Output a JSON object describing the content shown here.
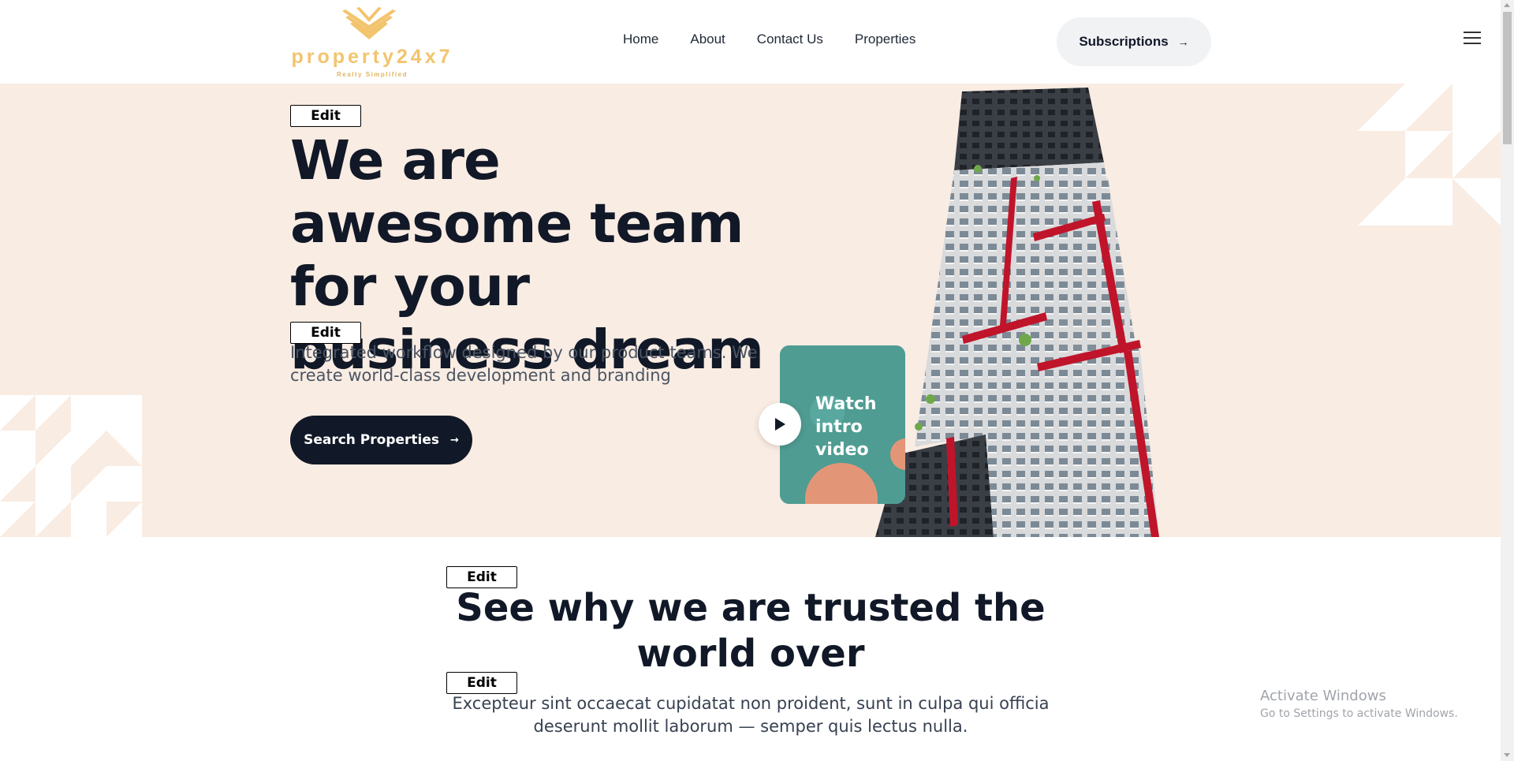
{
  "header": {
    "logo_text": "property24x7",
    "logo_tagline": "Realty Simplified",
    "nav": [
      "Home",
      "About",
      "Contact Us",
      "Properties"
    ],
    "subscriptions_label": "Subscriptions",
    "arrow": "→"
  },
  "hero": {
    "edit_label": "Edit",
    "title": "We are awesome team for your business dream",
    "subtitle": "Integrated workflow designed by our product teams. We create world-class development and branding",
    "search_label": "Search Properties",
    "video_label": "Watch intro video"
  },
  "trusted": {
    "edit_label": "Edit",
    "title": "See why we are trusted the world over",
    "subtitle": "Excepteur sint occaecat cupidatat non proident, sunt in culpa qui officia deserunt mollit laborum — semper quis lectus nulla."
  },
  "watermark": {
    "line1": "Activate Windows",
    "line2": "Go to Settings to activate Windows."
  },
  "colors": {
    "hero_bg": "#f9ece3",
    "dark": "#111827",
    "logo_gold": "#f2c46d",
    "video_teal": "#4f9c93",
    "accent_red": "#c0142a"
  }
}
